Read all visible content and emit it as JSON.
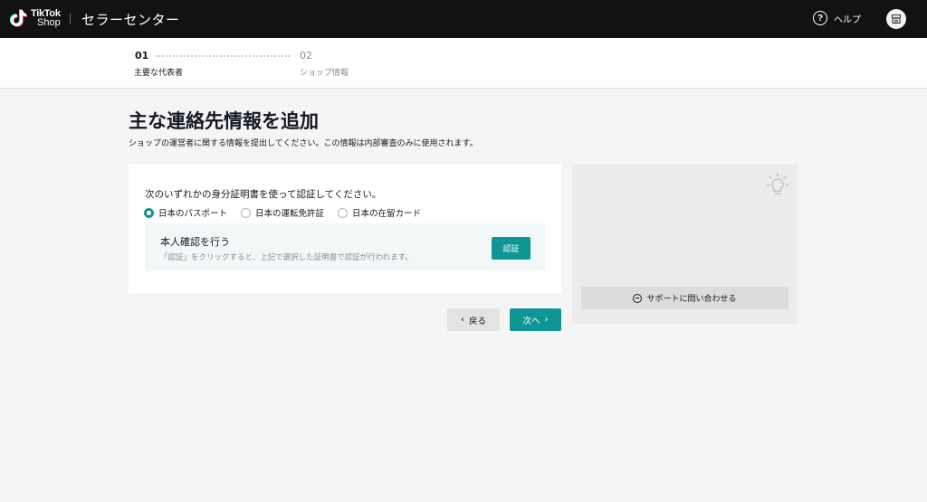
{
  "header": {
    "logo_line1": "TikTok",
    "logo_line2": "Shop",
    "app_title": "セラーセンター",
    "help_label": "ヘルプ",
    "help_icon_glyph": "?"
  },
  "stepper": {
    "steps": [
      {
        "number": "01",
        "label": "主要な代表者",
        "active": true
      },
      {
        "number": "02",
        "label": "ショップ情報",
        "active": false
      }
    ]
  },
  "page": {
    "title": "主な連絡先情報を追加",
    "description": "ショップの運営者に関する情報を提出してください。この情報は内部審査のみに使用されます。"
  },
  "identity_card": {
    "question": "次のいずれかの身分証明書を使って認証してください。",
    "options": [
      {
        "label": "日本のパスポート",
        "selected": true
      },
      {
        "label": "日本の運転免許証",
        "selected": false
      },
      {
        "label": "日本の在留カード",
        "selected": false
      }
    ],
    "verify": {
      "title": "本人確認を行う",
      "description": "「認証」をクリックすると、上記で選択した証明書で認証が行われます。",
      "button_label": "認証"
    }
  },
  "side_panel": {
    "support_label": "サポートに問い合わせる"
  },
  "actions": {
    "back_label": "戻る",
    "next_label": "次へ"
  },
  "colors": {
    "accent": "#0f9595",
    "topbar": "#121212",
    "page_bg": "#f5f5f5"
  }
}
